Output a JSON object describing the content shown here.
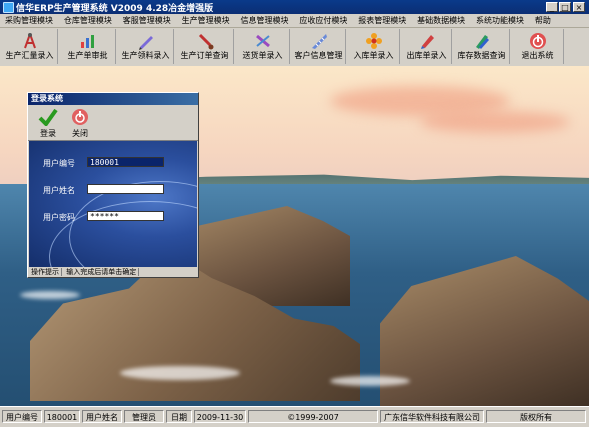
{
  "window": {
    "title": "信华ERP生产管理系统  V2009 4.28冶金增强版",
    "minimize": "_",
    "maximize": "□",
    "close": "×"
  },
  "menu": [
    "采购管理模块",
    "仓库管理模块",
    "客服管理模块",
    "生产管理模块",
    "信息管理模块",
    "应收应付模块",
    "报表管理模块",
    "基础数据模块",
    "系统功能模块",
    "帮助"
  ],
  "toolbar": [
    {
      "label": "生产汇量录入",
      "icon": "compass-icon"
    },
    {
      "label": "生产单审批",
      "icon": "chart-icon"
    },
    {
      "label": "生产领料录入",
      "icon": "pen-icon"
    },
    {
      "label": "生产订单查询",
      "icon": "brush-icon"
    },
    {
      "label": "送货单录入",
      "icon": "tools-icon"
    },
    {
      "label": "客户信息管理",
      "icon": "ruler-icon"
    },
    {
      "label": "入库单录入",
      "icon": "flower-icon"
    },
    {
      "label": "出库单录入",
      "icon": "paint-icon"
    },
    {
      "label": "库存数据查询",
      "icon": "crayon-icon"
    },
    {
      "label": "退出系统",
      "icon": "power-icon"
    }
  ],
  "login": {
    "title": "登录系统",
    "login_label": "登录",
    "close_label": "关闭",
    "user_id_label": "用户编号",
    "user_id_value": "180001",
    "user_name_label": "用户姓名",
    "user_name_value": "",
    "password_label": "用户密码",
    "password_value": "******",
    "status": [
      "操作提示",
      "输入完成后请单击确定"
    ]
  },
  "statusbar": {
    "user_id_label": "用户编号",
    "user_id": "180001",
    "user_name_label": "用户姓名",
    "user_name": "管理员",
    "date_label": "日期",
    "date": "2009-11-30",
    "copyright": "©1999-2007",
    "company": "广东信华软件科技有限公司",
    "rights": "版权所有"
  },
  "colors": {
    "titlebar": "#0b2e74",
    "dialog_panel": "#2b4f9e",
    "selection": "#0a246a"
  }
}
